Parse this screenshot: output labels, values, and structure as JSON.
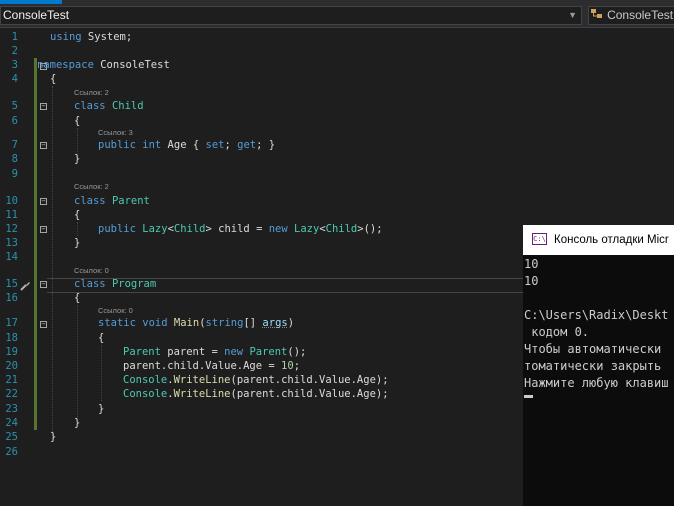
{
  "tab": {
    "active_label": ""
  },
  "navbar": {
    "project": "ConsoleTest",
    "member": "ConsoleTest.I",
    "dropdown_glyph": "▼",
    "class_icon": "class-icon"
  },
  "editor": {
    "line_numbers": [
      "1",
      "2",
      "3",
      "4",
      "5",
      "6",
      "7",
      "8",
      "9",
      "10",
      "11",
      "12",
      "13",
      "14",
      "15",
      "16",
      "17",
      "18",
      "19",
      "20",
      "21",
      "22",
      "23",
      "24",
      "25",
      "26"
    ],
    "codelens": {
      "child": "Ссылок: 2",
      "age": "Ссылок: 3",
      "parent": "Ссылок: 2",
      "program": "Ссылок: 0",
      "main": "Ссылок: 0"
    },
    "lines": {
      "l1": [
        "using",
        " System;"
      ],
      "l3": [
        "namespace",
        " ConsoleTest"
      ],
      "l4": "{",
      "l5": [
        "class",
        " ",
        "Child"
      ],
      "l6": "{",
      "l7": [
        "public",
        " ",
        "int",
        " Age { ",
        "set",
        "; ",
        "get",
        "; }"
      ],
      "l8": "}",
      "l10": [
        "class",
        " ",
        "Parent"
      ],
      "l11": "{",
      "l12": [
        "public",
        " ",
        "Lazy",
        "<",
        "Child",
        "> child = ",
        "new",
        " ",
        "Lazy",
        "<",
        "Child",
        ">();"
      ],
      "l13": "}",
      "l15": [
        "class",
        " ",
        "Program"
      ],
      "l16": "{",
      "l17": [
        "static",
        " ",
        "void",
        " ",
        "Main",
        "(",
        "string",
        "[] ",
        "args",
        ")"
      ],
      "l18": "{",
      "l19": [
        "Parent",
        " parent = ",
        "new",
        " ",
        "Parent",
        "();"
      ],
      "l20": [
        "parent.child.Value.Age = ",
        "10",
        ";"
      ],
      "l21": [
        "Console",
        ".",
        "WriteLine",
        "(parent.child.Value.Age);"
      ],
      "l22": [
        "Console",
        ".",
        "WriteLine",
        "(parent.child.Value.Age);"
      ],
      "l23": "}",
      "l24": "}",
      "l25": "}"
    },
    "fold_glyph": "−"
  },
  "console": {
    "title": "Консоль отладки Micr",
    "icon_text": "C:\\",
    "lines": [
      "10",
      "10",
      "",
      "C:\\Users\\Radix\\Deskt",
      " кодом 0.",
      "Чтобы автоматически",
      "томатически закрыть",
      "Нажмите любую клавиш"
    ]
  },
  "colors": {
    "editor_bg": "#1e1e1e",
    "keyword": "#569cd6",
    "type": "#4ec9b0",
    "method": "#dcdcaa",
    "number": "#b5cea8",
    "line_number": "#2b91af",
    "change_bar": "#577430",
    "console_bg": "#0c0c0c"
  }
}
